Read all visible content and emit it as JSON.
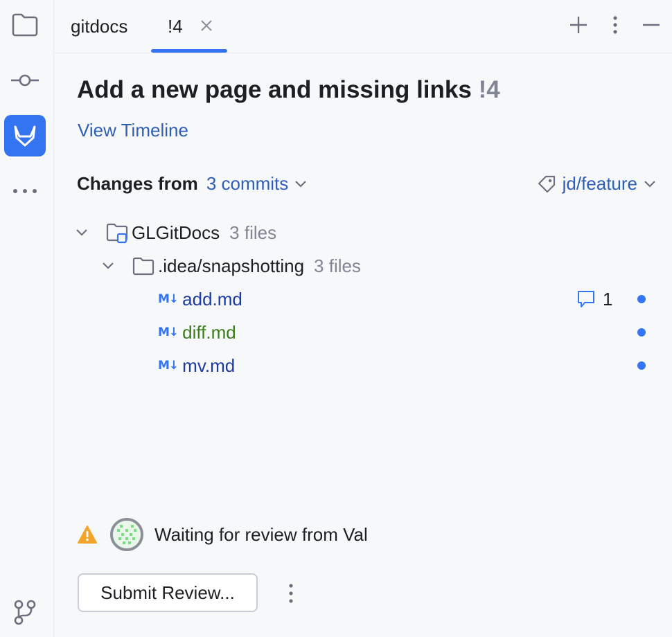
{
  "tabs": [
    {
      "label": "gitdocs"
    },
    {
      "label": "!4"
    }
  ],
  "review": {
    "title": "Add a new page and missing links",
    "number": "!4",
    "timeline_link": "View Timeline",
    "changes_label": "Changes from",
    "commits_label": "3 commits",
    "branch": "jd/feature"
  },
  "tree": {
    "root": {
      "name": "GLGitDocs",
      "count": "3 files"
    },
    "folder": {
      "name": ".idea/snapshotting",
      "count": "3 files"
    },
    "files": [
      {
        "badge": "M↓",
        "name": "add.md",
        "comments": "1"
      },
      {
        "badge": "M↓",
        "name": "diff.md"
      },
      {
        "badge": "M↓",
        "name": "mv.md"
      }
    ]
  },
  "status": {
    "text": "Waiting for review from Val"
  },
  "actions": {
    "submit_label": "Submit Review..."
  },
  "colors": {
    "accent": "#3574f0",
    "link": "#2f5eb6",
    "warning": "#f2a52b",
    "file_modified": "#1c3aa3",
    "file_added": "#3b7d1c"
  },
  "icons": [
    "folder-icon",
    "commit-icon",
    "gitlab-icon",
    "more-icon",
    "branches-icon",
    "close-icon",
    "plus-icon",
    "kebab-icon",
    "minimize-icon",
    "chevron-down-icon",
    "tag-icon",
    "module-folder-icon",
    "folder-icon",
    "comment-icon",
    "warning-icon"
  ]
}
